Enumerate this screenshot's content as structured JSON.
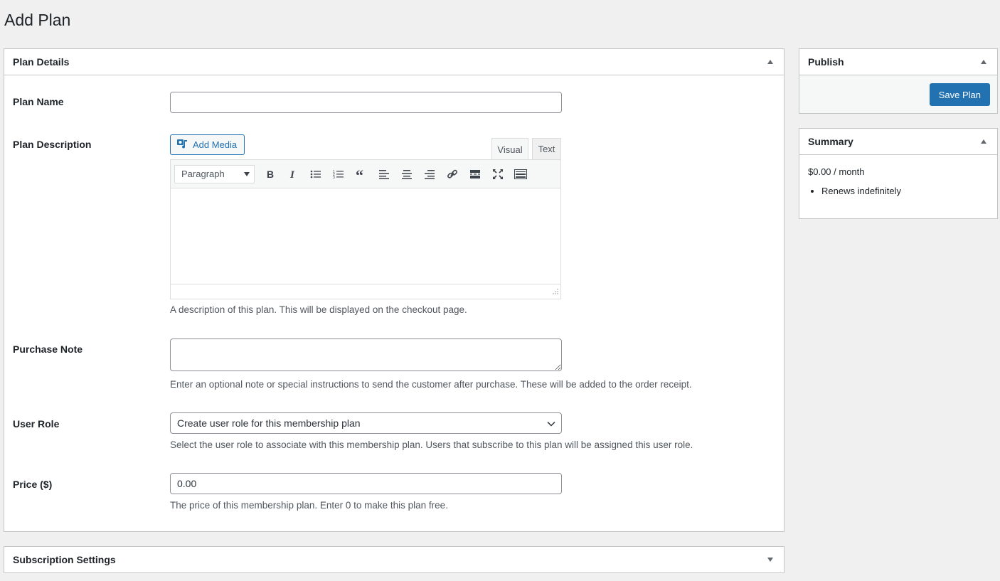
{
  "page": {
    "title": "Add Plan"
  },
  "plan_details": {
    "title": "Plan Details",
    "fields": {
      "plan_name": {
        "label": "Plan Name",
        "value": ""
      },
      "plan_description": {
        "label": "Plan Description",
        "add_media_label": "Add Media",
        "tabs": {
          "visual": "Visual",
          "text": "Text"
        },
        "format_select": "Paragraph",
        "toolbar_icons": [
          "bold-icon",
          "italic-icon",
          "bulleted-list-icon",
          "numbered-list-icon",
          "blockquote-icon",
          "align-left-icon",
          "align-center-icon",
          "align-right-icon",
          "link-icon",
          "read-more-icon",
          "fullscreen-icon",
          "toolbar-toggle-icon"
        ],
        "value": "",
        "help": "A description of this plan. This will be displayed on the checkout page."
      },
      "purchase_note": {
        "label": "Purchase Note",
        "value": "",
        "help": "Enter an optional note or special instructions to send the customer after purchase. These will be added to the order receipt."
      },
      "user_role": {
        "label": "User Role",
        "selected": "Create user role for this membership plan",
        "help": "Select the user role to associate with this membership plan. Users that subscribe to this plan will be assigned this user role."
      },
      "price": {
        "label": "Price ($)",
        "value": "0.00",
        "help": "The price of this membership plan. Enter 0 to make this plan free."
      }
    }
  },
  "publish": {
    "title": "Publish",
    "save_label": "Save Plan"
  },
  "summary": {
    "title": "Summary",
    "price_line": "$0.00 / month",
    "items": [
      "Renews indefinitely"
    ]
  },
  "subscription_settings": {
    "title": "Subscription Settings"
  },
  "colors": {
    "primary": "#2271b1",
    "background": "#f0f0f1",
    "border": "#c3c4c7"
  }
}
